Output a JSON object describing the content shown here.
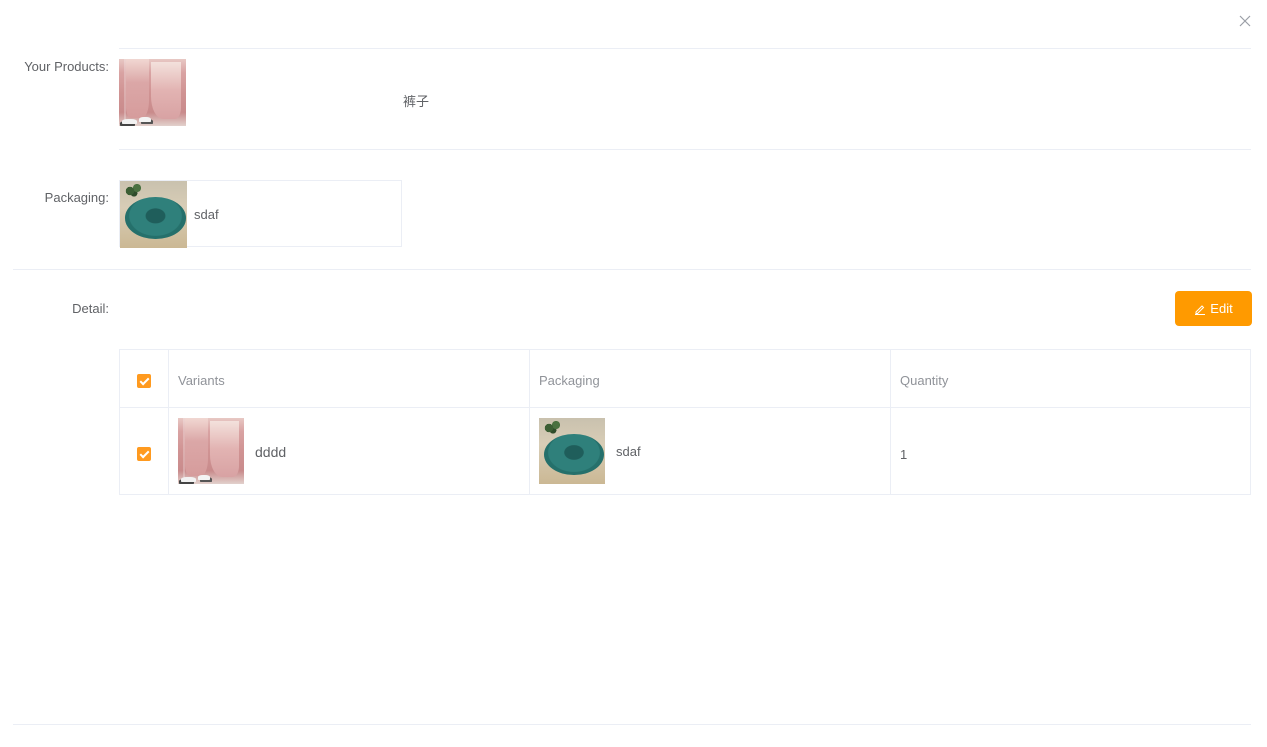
{
  "dialog": {
    "close_icon": "close-icon"
  },
  "products": {
    "label": "Your Products:",
    "name": "裤子",
    "image_icon": "pants-thumbnail"
  },
  "packaging": {
    "label": "Packaging:",
    "name": "sdaf",
    "image_icon": "cushion-thumbnail"
  },
  "detail": {
    "label": "Detail:",
    "edit_label": "Edit",
    "edit_icon": "pencil-icon",
    "accent_color": "#ff9a00"
  },
  "table": {
    "headers": {
      "variants": "Variants",
      "packaging": "Packaging",
      "quantity": "Quantity"
    },
    "select_all_checked": true,
    "rows": [
      {
        "checked": true,
        "variant": "dddd",
        "packaging": "sdaf",
        "quantity": "1"
      }
    ]
  }
}
